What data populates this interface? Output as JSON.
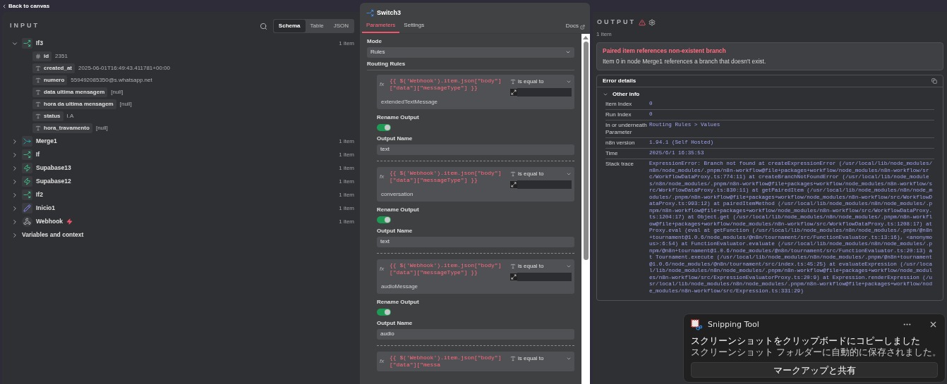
{
  "top_bar": {
    "back_link": "Back to canvas"
  },
  "input": {
    "title": "INPUT",
    "view_tabs": [
      {
        "label": "Schema",
        "selected": true
      },
      {
        "label": "Table",
        "selected": false
      },
      {
        "label": "JSON",
        "selected": false
      }
    ],
    "nodes": [
      {
        "name": "If3",
        "kind": "if",
        "expanded": true,
        "count": "1 item",
        "children": [
          {
            "kind": "number",
            "key": "id",
            "value": "2351"
          },
          {
            "kind": "string",
            "key": "created_at",
            "value": "2025-06-01T16:49:43.411781+00:00"
          },
          {
            "kind": "string",
            "key": "numero",
            "value": "559492085350@s.whatsapp.net"
          },
          {
            "kind": "string",
            "key": "data ultima mensagem",
            "value": "[null]"
          },
          {
            "kind": "string",
            "key": "hora da ultima mensagem",
            "value": "[null]"
          },
          {
            "kind": "string",
            "key": "status",
            "value": "I.A"
          },
          {
            "kind": "string",
            "key": "hora_travamento",
            "value": "[null]"
          }
        ]
      },
      {
        "name": "Merge1",
        "kind": "merge",
        "expanded": false,
        "count": "1 item"
      },
      {
        "name": "If",
        "kind": "if",
        "expanded": false,
        "count": "1 item"
      },
      {
        "name": "Supabase13",
        "kind": "supabase",
        "expanded": false,
        "count": "1 item"
      },
      {
        "name": "Supabase12",
        "kind": "supabase",
        "expanded": false,
        "count": "1 item"
      },
      {
        "name": "If2",
        "kind": "if",
        "expanded": false,
        "count": "1 item"
      },
      {
        "name": "Inicio1",
        "kind": "edit",
        "expanded": false,
        "count": "1 item"
      },
      {
        "name": "Webhook",
        "kind": "webhook",
        "trigger": true,
        "expanded": false,
        "count": "1 item"
      }
    ],
    "variables": {
      "label": "Variables and context",
      "expanded": false
    }
  },
  "node_panel": {
    "title": "Switch3",
    "tabs": [
      {
        "label": "Parameters",
        "selected": true
      },
      {
        "label": "Settings",
        "selected": false
      }
    ],
    "docs_link": "Docs",
    "mode": {
      "label": "Mode",
      "value": "Rules"
    },
    "routing_label": "Routing Rules",
    "rules": [
      {
        "prefix": "fx",
        "expression": "{{ $('Webhook').item.json[\"body\"][\"data\"][\"messageType\"] }}",
        "operator": "is equal to",
        "value": "extendedTextMessage",
        "rename_label": "Rename Output",
        "rename_on": true,
        "output_label": "Output Name",
        "output_name": "text"
      },
      {
        "prefix": "fx",
        "expression": "{{ $('Webhook').item.json[\"body\"][\"data\"][\"messageType\"] }}",
        "operator": "is equal to",
        "value": "conversation",
        "rename_label": "Rename Output",
        "rename_on": true,
        "output_label": "Output Name",
        "output_name": "text"
      },
      {
        "prefix": "fx",
        "expression": "{{ $('Webhook').item.json[\"body\"][\"data\"][\"messageType\"] }}",
        "operator": "is equal to",
        "value": "audioMessage",
        "rename_label": "Rename Output",
        "rename_on": true,
        "output_label": "Output Name",
        "output_name": "audio"
      },
      {
        "prefix": "fx",
        "expression": "{{ $('Webhook').item.json[\"body\"][\"data\"][\"messa",
        "operator": "is equal to"
      }
    ]
  },
  "output": {
    "title": "OUTPUT",
    "count": "1 item",
    "error": {
      "title": "Paired item references non-existent branch",
      "message": "Item 0 in node Merge1 references a branch that doesn't exist."
    },
    "details": {
      "title": "Error details",
      "section": {
        "label": "Other info",
        "expanded": true,
        "rows": [
          {
            "label": "Item Index",
            "value": "0"
          },
          {
            "label": "Run Index",
            "value": "0"
          },
          {
            "label": "In or underneath Parameter",
            "value": "Routing Rules > Values"
          },
          {
            "label": "n8n version",
            "value": "1.94.1 (Self Hosted)"
          },
          {
            "label": "Time",
            "value": "2025/6/1 16:35:53"
          },
          {
            "label": "Stack trace",
            "value": "ExpressionError: Branch not found at createExpressionError (/usr/local/lib/node_modules/n8n/node_modules/.pnpm/n8n-workflow@file+packages+workflow/node_modules/n8n-workflow/src/WorkflowDataProxy.ts:774:11) at createBranchNotFoundError (/usr/local/lib/node_modules/n8n/node_modules/.pnpm/n8n-workflow@file+packages+workflow/node_modules/n8n-workflow/src/WorkflowDataProxy.ts:830:11) at getPairedItem (/usr/local/lib/node_modules/n8n/node_modules/.pnpm/n8n-workflow@file+packages+workflow/node_modules/n8n-workflow/src/WorkflowDataProxy.ts:993:12) at pairedItemMethod (/usr/local/lib/node_modules/n8n/node_modules/.pnpm/n8n-workflow@file+packages+workflow/node_modules/n8n-workflow/src/WorkflowDataProxy.ts:1204:17) at Object.get (/usr/local/lib/node_modules/n8n/node_modules/.pnpm/n8n-workflow@file+packages+workflow/node_modules/n8n-workflow/src/WorkflowDataProxy.ts:1208:17) at Proxy.eval (eval at getFunction (/usr/local/lib/node_modules/n8n/node_modules/.pnpm/@n8n+tournament@1.0.6/node_modules/@n8n/tournament/src/FunctionEvaluator.ts:13:16), <anonymous>:6:54) at FunctionEvaluator.evaluate (/usr/local/lib/node_modules/n8n/node_modules/.pnpm/@n8n+tournament@1.0.6/node_modules/@n8n/tournament/src/FunctionEvaluator.ts:20:13) at Tournament.execute (/usr/local/lib/node_modules/n8n/node_modules/.pnpm/@n8n+tournament@1.0.6/node_modules/@n8n/tournament/src/index.ts:45:25) at evaluateExpression (/usr/local/lib/node_modules/n8n/node_modules/.pnpm/n8n-workflow@file+packages+workflow/node_modules/n8n-workflow/src/ExpressionEvaluatorProxy.ts:20:9) at Expression.renderExpression (/usr/local/lib/node_modules/n8n/node_modules/.pnpm/n8n-workflow@file+packages+workflow/node_modules/n8n-workflow/src/Expression.ts:331:29)"
          }
        ]
      }
    }
  },
  "toast": {
    "app": "Snipping Tool",
    "message": "スクリーンショットをクリップボードにコピーしました",
    "detail": "スクリーンショット フォルダーに自動的に保存されました。",
    "button": "マークアップと共有"
  }
}
